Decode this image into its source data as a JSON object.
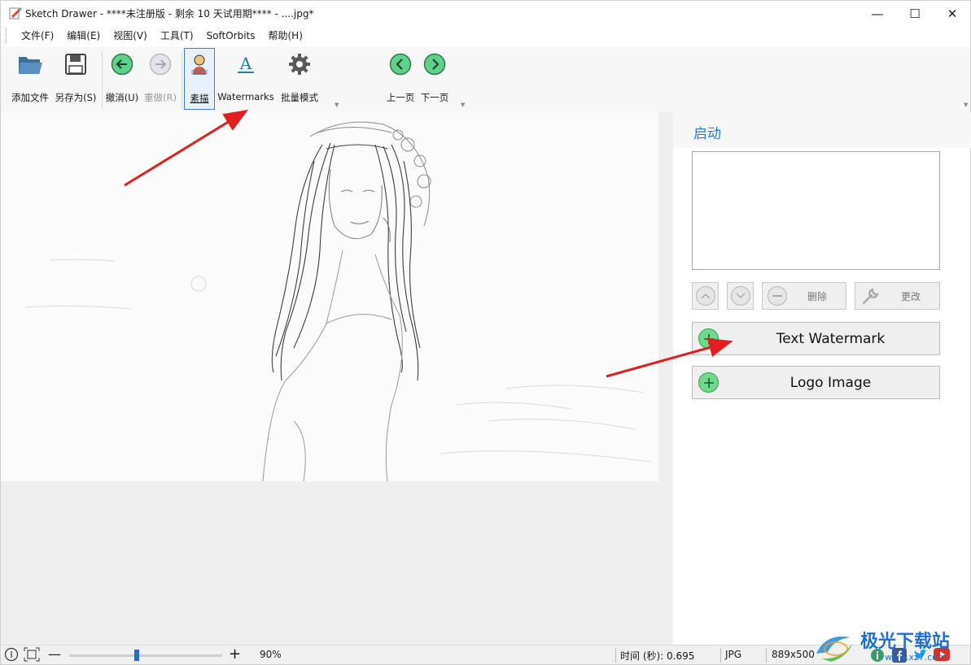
{
  "window": {
    "title": "Sketch Drawer - ****未注册版 - 剩余 10 天试用期**** - ....jpg*",
    "minimize": "—",
    "maximize": "☐",
    "close": "✕"
  },
  "menu": {
    "items": [
      "文件(F)",
      "编辑(E)",
      "视图(V)",
      "工具(T)",
      "SoftOrbits",
      "帮助(H)"
    ]
  },
  "toolbar": {
    "add_file": "添加文件",
    "save_as": "另存为(S)",
    "undo": "撤消(U)",
    "redo": "重做(R)",
    "sketch": "素描",
    "watermarks": "Watermarks",
    "batch": "批量模式",
    "prev": "上一页",
    "next": "下一页"
  },
  "panel": {
    "title": "启动",
    "delete": "删除",
    "change": "更改",
    "text_watermark": "Text Watermark",
    "logo_image": "Logo Image"
  },
  "status": {
    "zoom": "90%",
    "time": "时间 (秒): 0.695",
    "format": "JPG",
    "size": "889x500"
  },
  "zoom_slider": {
    "level": 0.44
  },
  "site_logo": {
    "name": "极光下载站",
    "url": "www.xz7.com"
  },
  "colors": {
    "accent_blue": "#2a7ad4",
    "nav_green": "#5fd18a",
    "plus_green": "#6ddb8b",
    "arrow_red": "#e02020"
  }
}
